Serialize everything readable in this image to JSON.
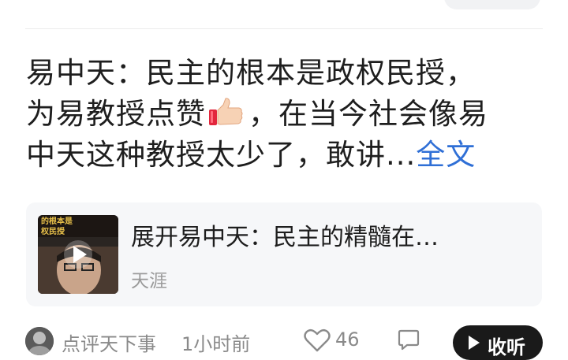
{
  "post": {
    "text_line1": "易中天：民主的根本是政权民授，",
    "text_line2_a": "为易教授点赞",
    "text_line2_b": "，在当今社会像易",
    "text_line3": "中天这种教授太少了，敢讲...",
    "fulltext_link": "全文",
    "emoji": "thumbs-up"
  },
  "link_card": {
    "thumb_overlay_line1": "的根本是",
    "thumb_overlay_line2": "权民授",
    "title": "展开易中天：民主的精髓在…",
    "source": "天涯"
  },
  "footer": {
    "author": "点评天下事",
    "time": "1小时前",
    "likes": "46",
    "listen_label": "收听"
  },
  "colors": {
    "link": "#2f6fd6",
    "card_bg": "#f6f7f9",
    "meta_text": "#8a8a8a"
  }
}
